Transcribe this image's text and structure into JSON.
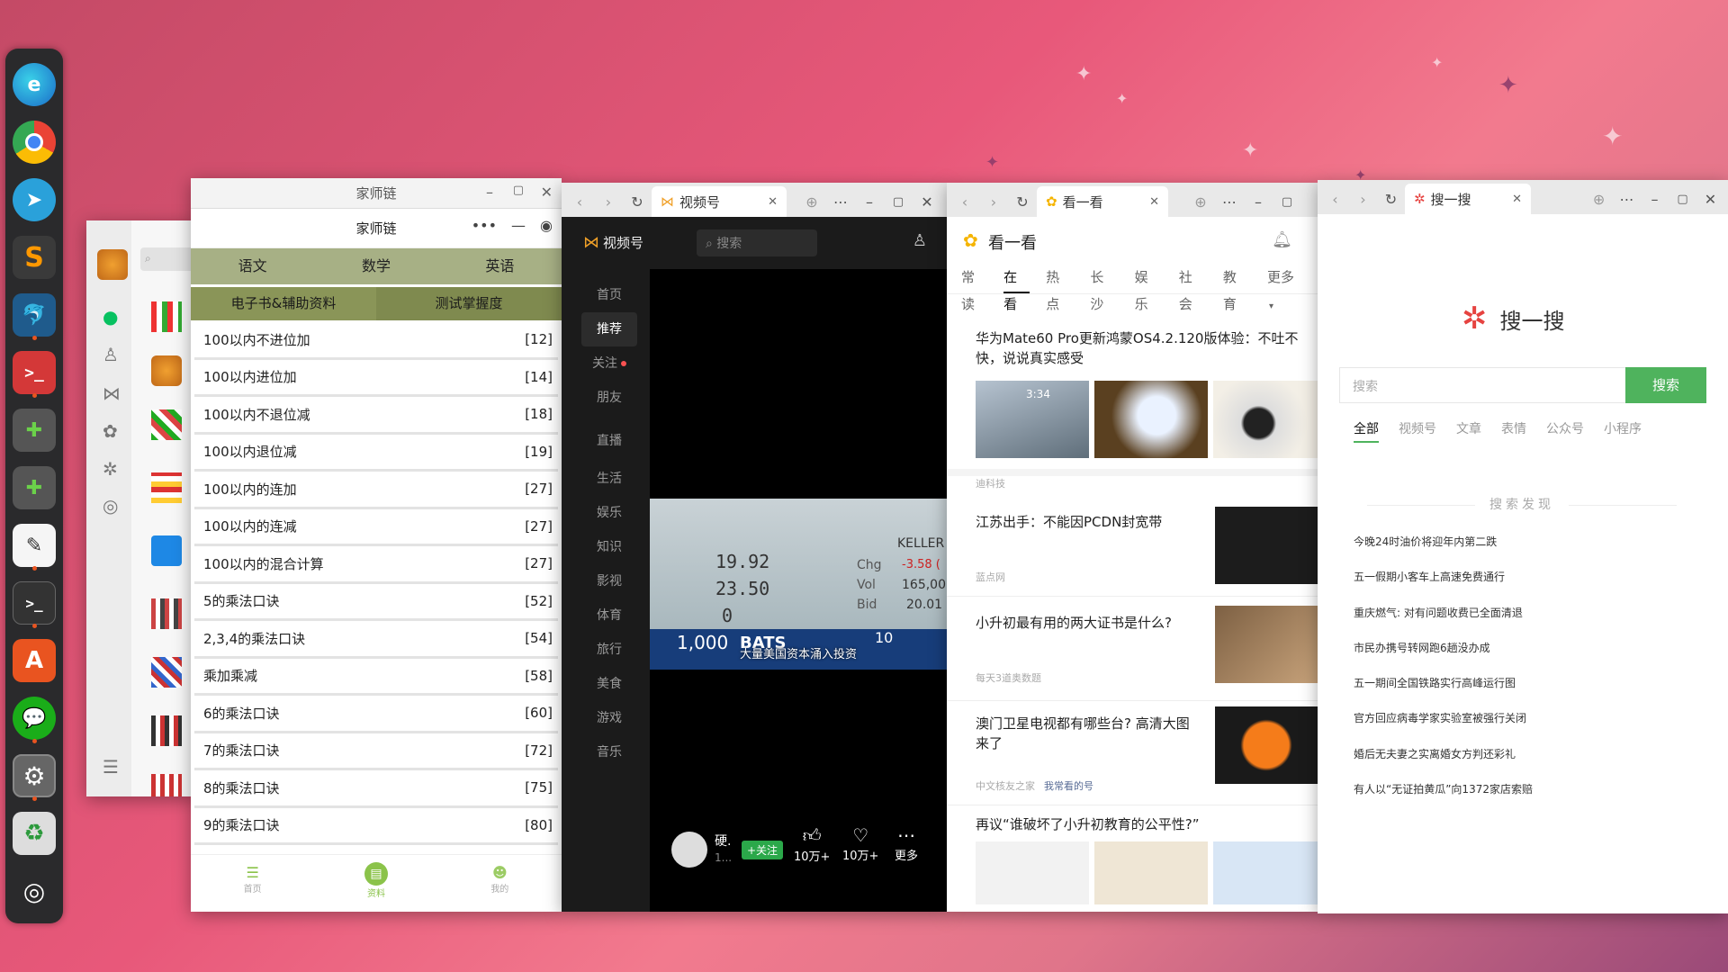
{
  "jiashilian": {
    "title": "家师链",
    "header": "家师链",
    "subjects": [
      "语文",
      "数学",
      "英语"
    ],
    "sub_tabs": [
      "电子书&辅助资料",
      "测试掌握度"
    ],
    "items": [
      {
        "label": "100以内不进位加",
        "page": "[12]"
      },
      {
        "label": "100以内进位加",
        "page": "[14]"
      },
      {
        "label": "100以内不退位减",
        "page": "[18]"
      },
      {
        "label": "100以内退位减",
        "page": "[19]"
      },
      {
        "label": "100以内的连加",
        "page": "[27]"
      },
      {
        "label": "100以内的连减",
        "page": "[27]"
      },
      {
        "label": "100以内的混合计算",
        "page": "[27]"
      },
      {
        "label": "5的乘法口诀",
        "page": "[52]"
      },
      {
        "label": "2,3,4的乘法口诀",
        "page": "[54]"
      },
      {
        "label": "乘加乘减",
        "page": "[58]"
      },
      {
        "label": "6的乘法口诀",
        "page": "[60]"
      },
      {
        "label": "7的乘法口诀",
        "page": "[72]"
      },
      {
        "label": "8的乘法口诀",
        "page": "[75]"
      },
      {
        "label": "9的乘法口诀",
        "page": "[80]"
      }
    ],
    "bottom_nav": [
      "首页",
      "资料",
      "我的"
    ]
  },
  "channels": {
    "tab": "视频号",
    "brand": "视频号",
    "search_placeholder": "搜索",
    "nav": [
      "首页",
      "推荐",
      "关注",
      "朋友",
      "直播",
      "生活",
      "娱乐",
      "知识",
      "影视",
      "体育",
      "旅行",
      "美食",
      "游戏",
      "音乐"
    ],
    "video_caption": "大量美国资本涌入投资",
    "ticker": {
      "r1": "19.92",
      "r2": "23.50",
      "r3": "0",
      "r4": "1,000",
      "brand": "BATS",
      "num": "10",
      "kw": "KELLER",
      "chg_label": "Chg",
      "chg": "-3.58 (",
      "vol_label": "Vol",
      "vol": "165,00",
      "bid_label": "Bid",
      "bid": "20.01"
    },
    "author": "硬.",
    "author_sub": "1...",
    "follow": "+关注",
    "likes": "10万+",
    "hearts": "10万+",
    "more": "更多"
  },
  "kanyikan": {
    "tab": "看一看",
    "title": "看一看",
    "categories": [
      "常读",
      "在看",
      "热点",
      "长沙",
      "娱乐",
      "社会",
      "教育",
      "更多"
    ],
    "articles": [
      {
        "title": "华为Mate60 Pro更新鸿蒙OS4.2.120版体验：不吐不快，说说真实感受",
        "source": "迪科技",
        "video_time": "3:34"
      },
      {
        "title": "江苏出手：不能因PCDN封宽带",
        "source": "蓝点网"
      },
      {
        "title": "小升初最有用的两大证书是什么?",
        "source": "每天3道奥数题"
      },
      {
        "title": "澳门卫星电视都有哪些台? 高清大图来了",
        "source": "中文核友之家",
        "source_tag": "我常看的号"
      },
      {
        "title": "再议“谁破坏了小升初教育的公平性?”"
      }
    ]
  },
  "souyisou": {
    "tab": "搜一搜",
    "logo_text": "搜一搜",
    "search_placeholder": "搜索",
    "search_button": "搜索",
    "filters": [
      "全部",
      "视频号",
      "文章",
      "表情",
      "公众号",
      "小程序"
    ],
    "discover_title": "搜索发现",
    "discover": [
      "今晚24时油价将迎年内第二跌",
      "五一假期小客车上高速免费通行",
      "重庆燃气: 对有问题收费已全面清退",
      "市民办携号转网跑6趟没办成",
      "五一期间全国铁路实行高峰运行图",
      "官方回应病毒学家实验室被强行关闭",
      "婚后无夫妻之实离婚女方判还彩礼",
      "有人以“无证拍黄瓜”向1372家店索赔"
    ]
  },
  "colors": {
    "wechat_green": "#07c160",
    "olive": "#7f8a4f",
    "search_green": "#4fb35d"
  }
}
